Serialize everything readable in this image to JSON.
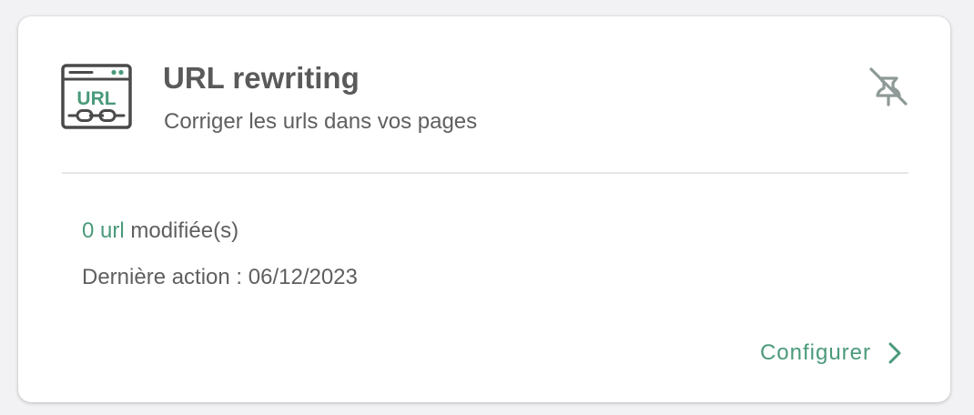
{
  "module": {
    "icon": "url-browser-chain-icon",
    "icon_text": "URL",
    "title": "URL rewriting",
    "subtitle": "Corriger les urls dans vos pages"
  },
  "actions": {
    "unpin_icon": "unpin-icon"
  },
  "stats": {
    "count_value": "0 url",
    "count_label": " modifiée(s)",
    "last_action": "Dernière action : 06/12/2023"
  },
  "footer": {
    "configure_label": "Configurer",
    "chevron_icon": "chevron-right-icon"
  },
  "colors": {
    "accent": "#4a9a7a",
    "text": "#5f5f5f",
    "title": "#5a5a5a",
    "icon_dark": "#4a4a4a",
    "unpin_icon": "#8f9a98",
    "divider": "#e6e6e6",
    "background": "#f2f2f4",
    "card": "#ffffff"
  }
}
